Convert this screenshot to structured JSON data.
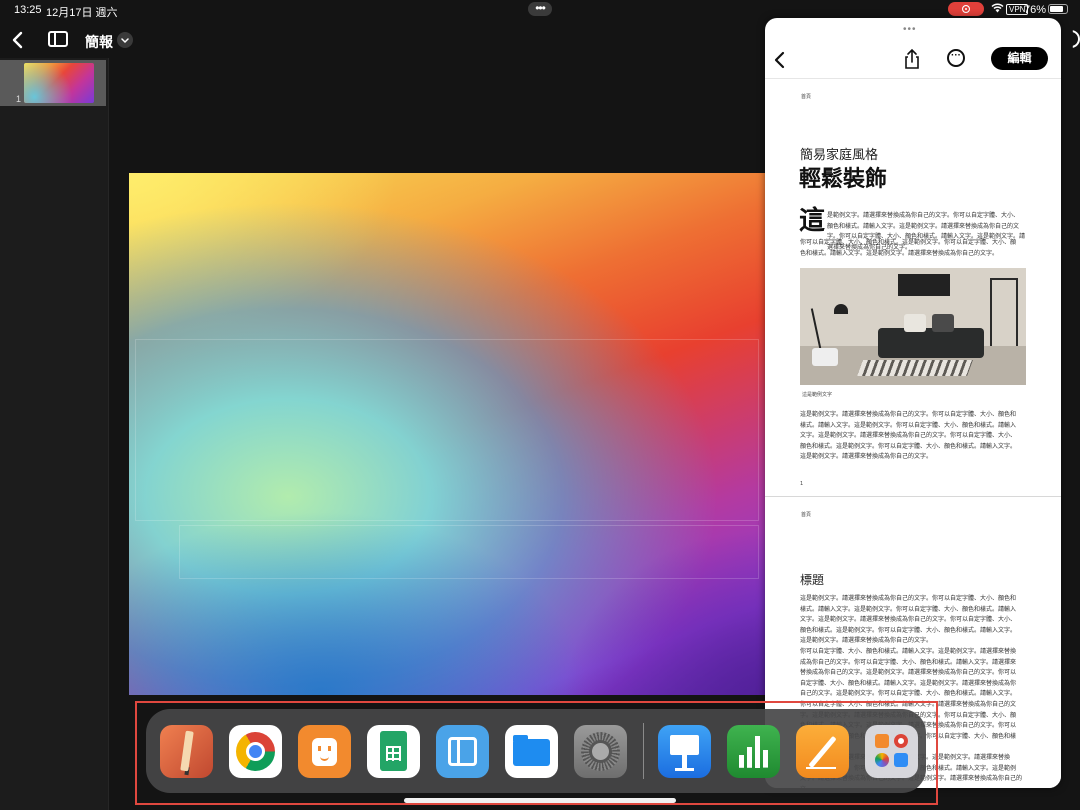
{
  "status_bar": {
    "time": "13:25",
    "date": "12月17日 週六",
    "vpn": "VPN",
    "battery": "76%"
  },
  "keynote": {
    "title": "簡報",
    "slide_thumbnails": [
      {
        "number": "1"
      }
    ]
  },
  "slideover": {
    "edit_label": "編輯",
    "page1": {
      "header": "首頁",
      "subtitle": "簡易家庭風格",
      "headline": "輕鬆裝飾",
      "drop_cap": "這",
      "intro_first": "是範例文字。請選擇來替換成為你自己的文字。你可以自定字體、大小、\n顏色和樣式。請輸入文字。這是範例文字。請選擇來替換成為你自己的文字。你可以自定字體、大小、顏色和樣式。請輸入文字。這是範例文字。請選擇來替換成為你自己的文字。",
      "intro_rest": "你可以自定字體、大小、顏色和樣式。這是範例文字。你可以自定字體、大小、顏\n色和樣式。請輸入文字。這是範例文字。請選擇來替換成為你自己的文字。",
      "caption": "這是範例文字",
      "body": "這是範例文字。請選擇來替換成為你自己的文字。你可以自定字體、大小、顏色和\n樣式。請輸入文字。這是範例文字。你可以自定字體、大小、顏色和樣式。請輸入\n文字。這是範例文字。請選擇來替換成為你自己的文字。你可以自定字體、大小、\n顏色和樣式。這是範例文字。你可以自定字體、大小、顏色和樣式。請輸入文字。\n這是範例文字。請選擇來替換成為你自己的文字。",
      "page_number": "1"
    },
    "page2": {
      "header": "首頁",
      "title": "標題",
      "body1": "這是範例文字。請選擇來替換成為你自己的文字。你可以自定字體、大小、顏色和\n樣式。請輸入文字。這是範例文字。你可以自定字體、大小、顏色和樣式。請輸入\n文字。這是範例文字。請選擇來替換成為你自己的文字。你可以自定字體、大小、\n顏色和樣式。這是範例文字。你可以自定字體、大小、顏色和樣式。請輸入文字。\n這是範例文字。請選擇來替換成為你自己的文字。",
      "body2": "你可以自定字體、大小、顏色和樣式。請輸入文字。這是範例文字。請選擇來替換\n成為你自己的文字。你可以自定字體、大小、顏色和樣式。請輸入文字。請選擇來\n替換成為你自己的文字。這是範例文字。請選擇來替換成為你自己的文字。你可以\n自定字體、大小、顏色和樣式。請輸入文字。這是範例文字。請選擇來替換成為你\n自己的文字。這是範例文字。你可以自定字體、大小、顏色和樣式。請輸入文字。\n你可以自定字體、大小、顏色和樣式。請輸入文字。請選擇來替換成為你自己的文\n字。這是範例文字。請選擇來替換成為你自己的文字。你可以自定字體、大小、顏\n色和樣式。請輸入文字。這是範例文字。請選擇來替換成為你自己的文字。你可以\n自定字體、大小、顏色和樣式。這是範例文字。你可以自定字體、大小、顏色和樣式。\n這是範例文字。請選擇來替換成為你自己的文字。這是範例文字。請選擇來替換\n成為你自己的文字。你可以自定字體、大小、顏色和樣式。請輸入文字。這是範例\n文字。請選擇來替換成為你自己的文字。這是範例文字。請選擇來替換成為你自己的文\n字。你可以自定字體、大小、顏色和樣式。請輸入文字。這是範例文字。你可以自定"
    }
  },
  "dock": {
    "apps": [
      {
        "icon": "sketchbook-icon"
      },
      {
        "icon": "chrome-icon"
      },
      {
        "icon": "face-app-icon"
      },
      {
        "icon": "google-sheets-icon"
      },
      {
        "icon": "book-app-icon"
      },
      {
        "icon": "files-icon"
      },
      {
        "icon": "settings-icon"
      },
      {
        "icon": "keynote-icon"
      },
      {
        "icon": "numbers-icon"
      },
      {
        "icon": "pages-icon"
      },
      {
        "icon": "app-folder-icon"
      }
    ],
    "highlight_color": "#e0483f"
  }
}
